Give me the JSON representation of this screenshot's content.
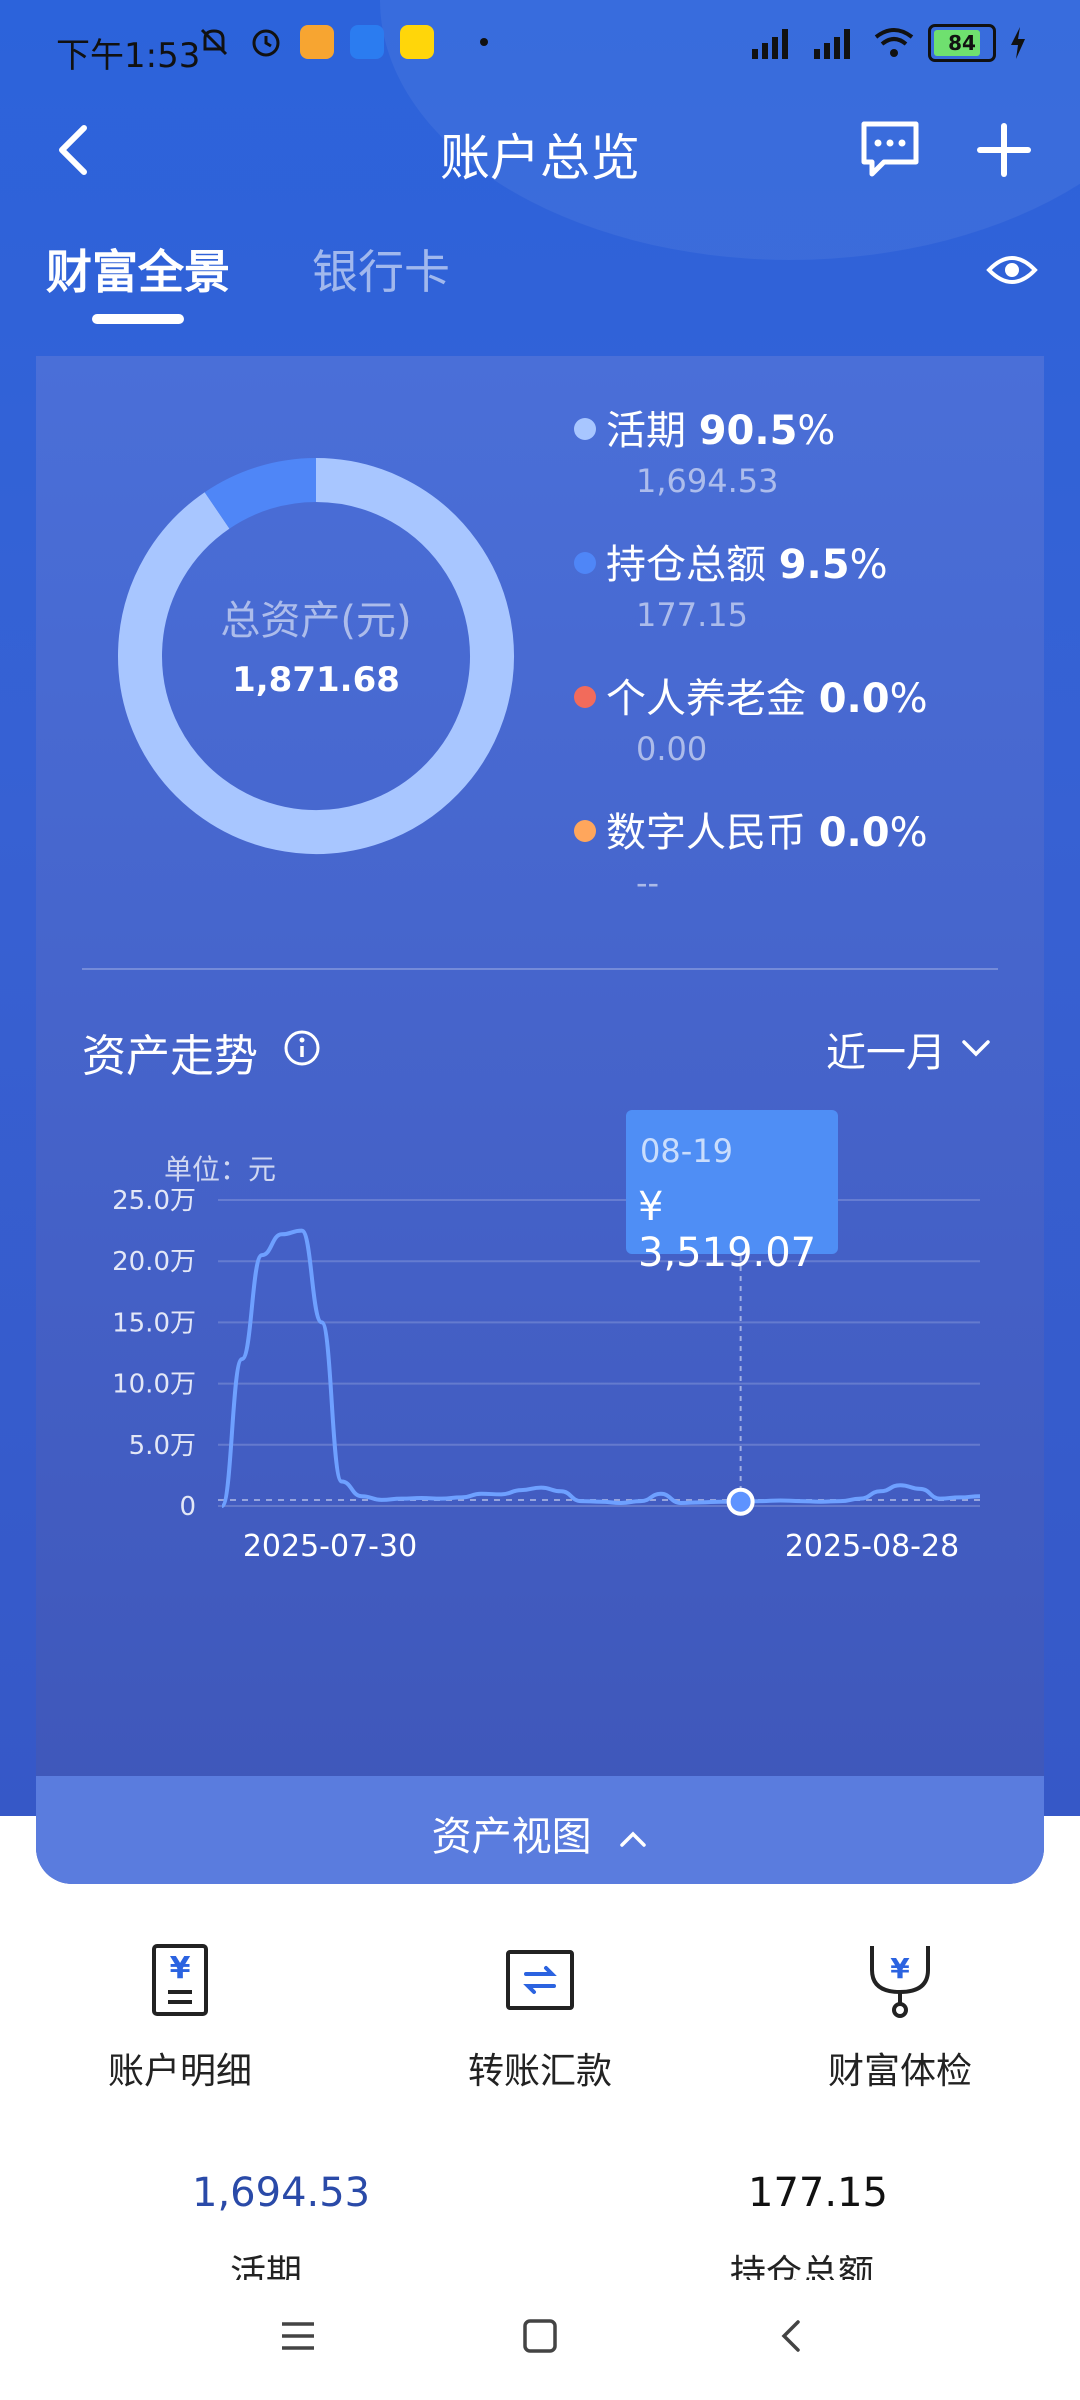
{
  "status_bar": {
    "time": "下午1:53",
    "battery": "84",
    "icons": [
      "mute-icon",
      "alarm-icon",
      "app-icon",
      "app-icon",
      "app-icon",
      "signal-icon",
      "signal-icon",
      "wifi-icon",
      "battery-icon",
      "charging-icon"
    ]
  },
  "nav": {
    "title": "账户总览",
    "back_icon": "back-icon",
    "message_icon": "message-icon",
    "add_icon": "add-icon"
  },
  "tabs": [
    {
      "label": "财富全景",
      "active": true
    },
    {
      "label": "银行卡",
      "active": false
    }
  ],
  "donut": {
    "label": "总资产(元)",
    "value": "1,871.68"
  },
  "legend": [
    {
      "name": "活期",
      "pct": "90.5",
      "pct_suffix": "%",
      "amount": "1,694.53",
      "color": "#a8c6ff",
      "fraction": 0.905
    },
    {
      "name": "持仓总额",
      "pct": "9.5",
      "pct_suffix": "%",
      "amount": "177.15",
      "color": "#4f86f7",
      "fraction": 0.095
    },
    {
      "name": "个人养老金",
      "pct": "0.0",
      "pct_suffix": "%",
      "amount": "0.00",
      "color": "#f26b5b",
      "fraction": 0
    },
    {
      "name": "数字人民币",
      "pct": "0.0",
      "pct_suffix": "%",
      "amount": "--",
      "color": "#ffa65c",
      "fraction": 0
    }
  ],
  "trend": {
    "title": "资产走势",
    "period": "近一月",
    "unit": "单位：元"
  },
  "chart_data": {
    "type": "line",
    "y_ticks": [
      "25.0万",
      "20.0万",
      "15.0万",
      "10.0万",
      "5.0万",
      "0"
    ],
    "ylim": [
      0,
      250000
    ],
    "x_labels": [
      "2025-07-30",
      "2025-08-28"
    ],
    "values": [
      0,
      120000,
      205000,
      222000,
      225000,
      150000,
      20000,
      8000,
      5000,
      6000,
      6500,
      6000,
      7000,
      10000,
      9500,
      13000,
      15000,
      12000,
      4000,
      3500,
      2500,
      4000,
      10000,
      2500,
      3000,
      3500,
      3519.07,
      4000,
      4500,
      4000,
      3500,
      4000,
      6000,
      12000,
      17000,
      14000,
      6000,
      7000,
      8000
    ],
    "highlight": {
      "index": 26,
      "date": "08-19",
      "value": "¥ 3,519.07"
    },
    "line_color": "#6ea0ff",
    "grid": true
  },
  "asset_view": {
    "label": "资产视图"
  },
  "shortcuts": [
    {
      "label": "账户明细",
      "icon": "account-detail-icon"
    },
    {
      "label": "转账汇款",
      "icon": "transfer-icon"
    },
    {
      "label": "财富体检",
      "icon": "wealth-check-icon"
    }
  ],
  "summary": [
    {
      "value": "1,694.53",
      "label": "活期",
      "color": "#2a4aa8"
    },
    {
      "value": "177.15",
      "label": "持仓总额",
      "color": "#111111"
    }
  ]
}
